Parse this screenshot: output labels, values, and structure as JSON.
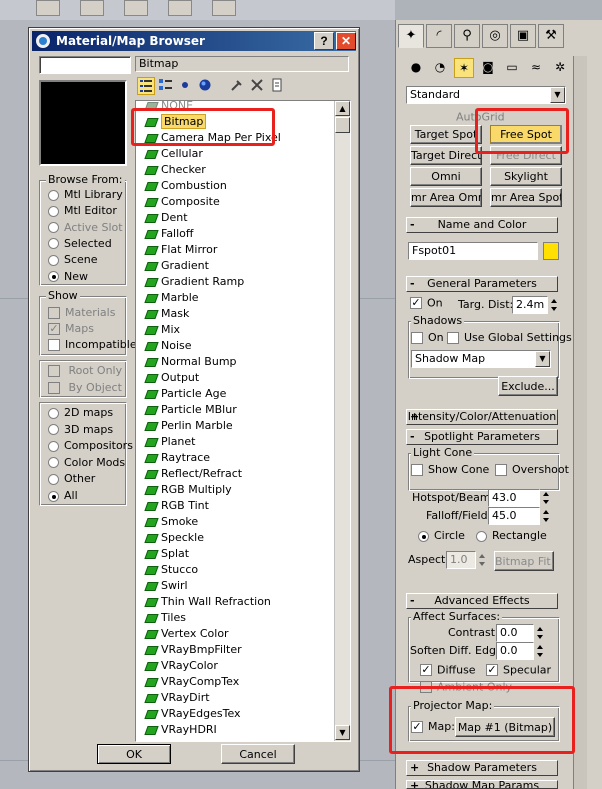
{
  "window": {
    "title": "Material/Map Browser",
    "help_label": "?",
    "close_label": "✕",
    "name_value": "",
    "path_label": "Bitmap"
  },
  "browse_from": {
    "label": "Browse From:",
    "options": [
      {
        "label": "Mtl Library",
        "selected": false,
        "enabled": true
      },
      {
        "label": "Mtl Editor",
        "selected": false,
        "enabled": true
      },
      {
        "label": "Active Slot",
        "selected": false,
        "enabled": false
      },
      {
        "label": "Selected",
        "selected": false,
        "enabled": true
      },
      {
        "label": "Scene",
        "selected": false,
        "enabled": true
      },
      {
        "label": "New",
        "selected": true,
        "enabled": true
      }
    ]
  },
  "show": {
    "label": "Show",
    "options": [
      {
        "label": "Materials",
        "checked": false,
        "enabled": false
      },
      {
        "label": "Maps",
        "checked": true,
        "enabled": false
      },
      {
        "label": "Incompatible",
        "checked": false,
        "enabled": true
      }
    ],
    "root_only": "Root Only",
    "by_object": "By Object"
  },
  "map_types": {
    "options": [
      {
        "label": "2D maps",
        "selected": false
      },
      {
        "label": "3D maps",
        "selected": false
      },
      {
        "label": "Compositors",
        "selected": false
      },
      {
        "label": "Color Mods",
        "selected": false
      },
      {
        "label": "Other",
        "selected": false
      },
      {
        "label": "All",
        "selected": true
      }
    ]
  },
  "map_list": {
    "items": [
      {
        "label": "NONE",
        "state": "disabled"
      },
      {
        "label": "Bitmap",
        "state": "selected"
      },
      {
        "label": "Camera Map Per Pixel",
        "state": "normal"
      },
      {
        "label": "Cellular",
        "state": "normal"
      },
      {
        "label": "Checker",
        "state": "normal"
      },
      {
        "label": "Combustion",
        "state": "normal"
      },
      {
        "label": "Composite",
        "state": "normal"
      },
      {
        "label": "Dent",
        "state": "normal"
      },
      {
        "label": "Falloff",
        "state": "normal"
      },
      {
        "label": "Flat Mirror",
        "state": "normal"
      },
      {
        "label": "Gradient",
        "state": "normal"
      },
      {
        "label": "Gradient Ramp",
        "state": "normal"
      },
      {
        "label": "Marble",
        "state": "normal"
      },
      {
        "label": "Mask",
        "state": "normal"
      },
      {
        "label": "Mix",
        "state": "normal"
      },
      {
        "label": "Noise",
        "state": "normal"
      },
      {
        "label": "Normal Bump",
        "state": "normal"
      },
      {
        "label": "Output",
        "state": "normal"
      },
      {
        "label": "Particle Age",
        "state": "normal"
      },
      {
        "label": "Particle MBlur",
        "state": "normal"
      },
      {
        "label": "Perlin Marble",
        "state": "normal"
      },
      {
        "label": "Planet",
        "state": "normal"
      },
      {
        "label": "Raytrace",
        "state": "normal"
      },
      {
        "label": "Reflect/Refract",
        "state": "normal"
      },
      {
        "label": "RGB Multiply",
        "state": "normal"
      },
      {
        "label": "RGB Tint",
        "state": "normal"
      },
      {
        "label": "Smoke",
        "state": "normal"
      },
      {
        "label": "Speckle",
        "state": "normal"
      },
      {
        "label": "Splat",
        "state": "normal"
      },
      {
        "label": "Stucco",
        "state": "normal"
      },
      {
        "label": "Swirl",
        "state": "normal"
      },
      {
        "label": "Thin Wall Refraction",
        "state": "normal"
      },
      {
        "label": "Tiles",
        "state": "normal"
      },
      {
        "label": "Vertex Color",
        "state": "normal"
      },
      {
        "label": "VRayBmpFilter",
        "state": "normal"
      },
      {
        "label": "VRayColor",
        "state": "normal"
      },
      {
        "label": "VRayCompTex",
        "state": "normal"
      },
      {
        "label": "VRayDirt",
        "state": "normal"
      },
      {
        "label": "VRayEdgesTex",
        "state": "normal"
      },
      {
        "label": "VRayHDRI",
        "state": "normal"
      }
    ]
  },
  "buttons": {
    "ok": "OK",
    "cancel": "Cancel"
  },
  "command_panel": {
    "category": "Standard",
    "autogrid_label": "AutoGrid",
    "object_types": [
      {
        "label": "Target Spot",
        "state": "normal"
      },
      {
        "label": "Free Spot",
        "state": "active"
      },
      {
        "label": "Target Direct",
        "state": "normal"
      },
      {
        "label": "Free Direct",
        "state": "disabled"
      },
      {
        "label": "Omni",
        "state": "normal"
      },
      {
        "label": "Skylight",
        "state": "normal"
      },
      {
        "label": "mr Area Omni",
        "state": "normal"
      },
      {
        "label": "mr Area Spot",
        "state": "normal"
      }
    ],
    "name_and_color": {
      "header": "Name and Color",
      "name": "Fspot01",
      "color": "#ffe000"
    },
    "general": {
      "header": "General Parameters",
      "on_label": "On",
      "targ_dist_label": "Targ. Dist:",
      "targ_dist": "2.4m",
      "shadows_label": "Shadows",
      "shadows_on_label": "On",
      "use_global_label": "Use Global Settings",
      "shadow_type": "Shadow Map",
      "exclude_label": "Exclude..."
    },
    "intensity_header": "Intensity/Color/Attenuation",
    "spotlight": {
      "header": "Spotlight Parameters",
      "light_cone_label": "Light Cone",
      "show_cone_label": "Show Cone",
      "overshoot_label": "Overshoot",
      "hotspot_label": "Hotspot/Beam:",
      "hotspot": "43.0",
      "falloff_label": "Falloff/Field:",
      "falloff": "45.0",
      "circle_label": "Circle",
      "rectangle_label": "Rectangle",
      "aspect_label": "Aspect:",
      "aspect": "1.0",
      "bitmap_fit_label": "Bitmap Fit..."
    },
    "advanced": {
      "header": "Advanced Effects",
      "affect_surfaces_label": "Affect Surfaces:",
      "contrast_label": "Contrast:",
      "contrast": "0.0",
      "soften_label": "Soften Diff. Edge:",
      "soften": "0.0",
      "diffuse_label": "Diffuse",
      "specular_label": "Specular",
      "ambient_only_label": "Ambient Only",
      "projector_map_label": "Projector Map:",
      "map_label": "Map:",
      "map_button": "Map #1 (Bitmap)"
    },
    "shadow_params_header": "Shadow Parameters",
    "shadow_map_params_header": "Shadow Map Params"
  },
  "colors": {
    "highlight": "#e8201e",
    "title_bar": "#0a246a",
    "selection": "#f8d969"
  }
}
